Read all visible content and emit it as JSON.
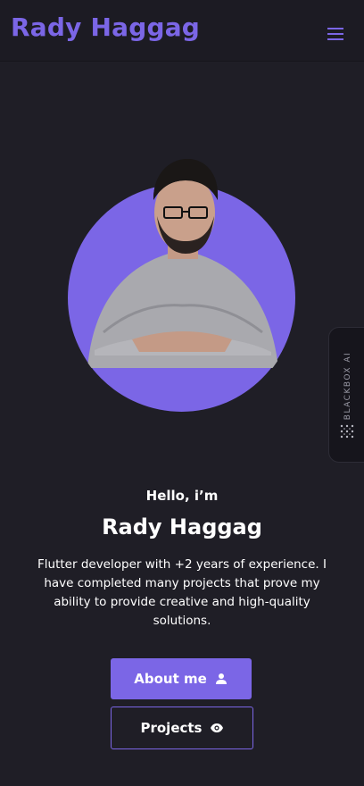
{
  "header": {
    "brand": "Rady Haggag",
    "menu_icon": "hamburger-menu-icon"
  },
  "hero": {
    "greeting": "Hello, i’m",
    "name": "Rady Haggag",
    "description": "Flutter developer with +2 years of experience. I have completed many projects that prove my ability to provide creative and high-quality solutions.",
    "about_button": "About me",
    "about_icon": "person-icon",
    "projects_button": "Projects",
    "projects_icon": "eye-icon"
  },
  "side_widget": {
    "label": "BLACKBOX AI",
    "icon": "blackbox-dots-icon"
  },
  "colors": {
    "accent": "#7b66e6",
    "background": "#1f1e26",
    "appbar": "#1c1b23"
  }
}
